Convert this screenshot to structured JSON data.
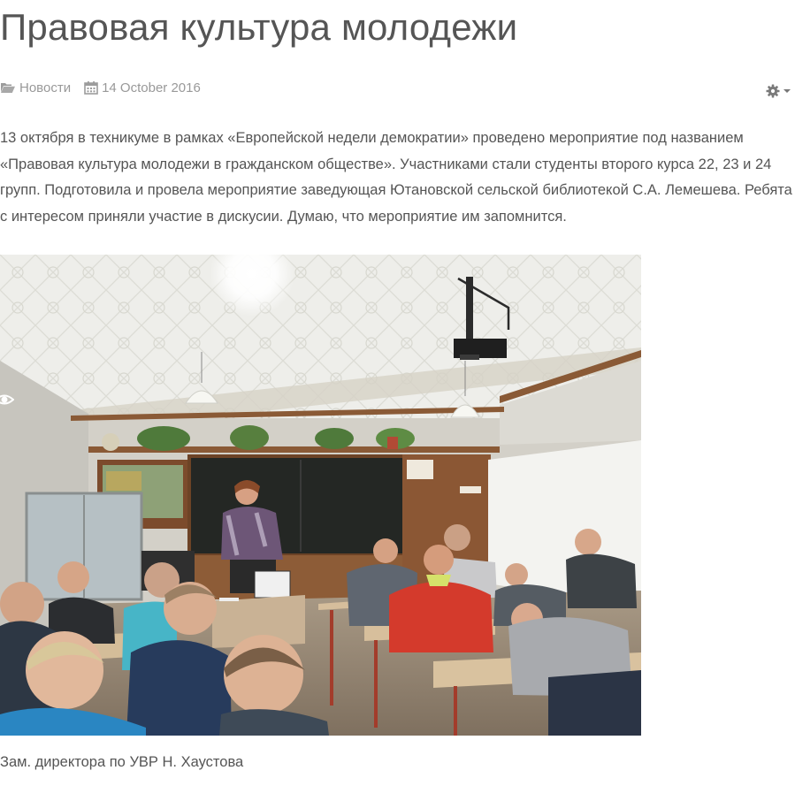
{
  "article": {
    "title": "Правовая культура молодежи",
    "meta": {
      "category": "Новости",
      "category_icon": "folder-open-icon",
      "date": "14 October 2016",
      "date_icon": "calendar-icon"
    },
    "tools": {
      "icon": "gear-icon",
      "dropdown_icon": "caret-down-icon"
    },
    "body": "13 октября в техникуме в рамках «Европейской недели демократии» проведено мероприятие под названием «Правовая культура молодежи в гражданском обществе». Участниками стали студенты второго курса 22, 23 и 24 групп. Подготовила и провела мероприятие заведующая Ютановской сельской библиотекой С.А. Лемешева. Ребята с интересом приняли участие в дискусии. Думаю, что мероприятие им запомнится.",
    "photo_overlay_icon": "eye-icon",
    "caption": "Зам. директора по УВР Н. Хаустова"
  },
  "colors": {
    "text": "#555555",
    "meta": "#999999",
    "icon": "#777777"
  }
}
